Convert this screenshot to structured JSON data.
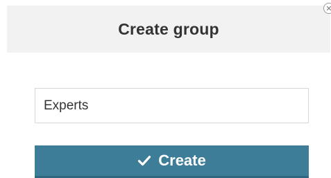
{
  "dialog": {
    "title": "Create group",
    "close_icon": "close-icon"
  },
  "form": {
    "group_name_value": "Experts"
  },
  "actions": {
    "create_label": "Create",
    "create_icon": "checkmark-icon"
  },
  "colors": {
    "header_bg": "#f2f2f2",
    "button_bg": "#3d7d97",
    "button_text": "#ffffff",
    "title_text": "#333333"
  }
}
